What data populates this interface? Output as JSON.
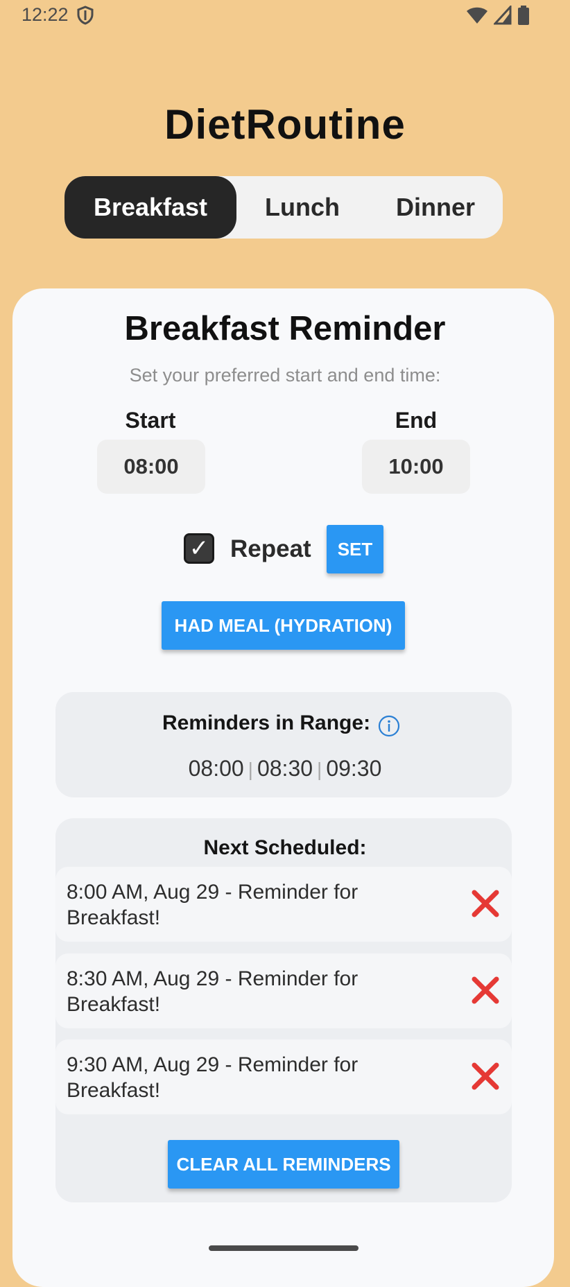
{
  "status_bar": {
    "time": "12:22",
    "left_icons": [
      "shield-icon"
    ],
    "right_icons": [
      "wifi-icon",
      "cell-signal-icon",
      "battery-icon"
    ]
  },
  "app": {
    "title": "DietRoutine"
  },
  "tabs": [
    {
      "label": "Breakfast",
      "selected": true
    },
    {
      "label": "Lunch",
      "selected": false
    },
    {
      "label": "Dinner",
      "selected": false
    }
  ],
  "reminder": {
    "title": "Breakfast Reminder",
    "subtitle": "Set your preferred start and end time:",
    "start_label": "Start",
    "start_value": "08:00",
    "end_label": "End",
    "end_value": "10:00",
    "repeat_label": "Repeat",
    "repeat_checked": true,
    "checkmark": "✓",
    "set_button": "SET",
    "had_meal_button": "HAD MEAL (HYDRATION)"
  },
  "range": {
    "title": "Reminders in Range:",
    "info_icon": "info-icon",
    "times": [
      "08:00",
      "08:30",
      "09:30"
    ],
    "separator": "|"
  },
  "scheduled": {
    "title": "Next Scheduled:",
    "items": [
      {
        "text": "8:00 AM, Aug 29 - Reminder for Breakfast!",
        "delete_icon": "cross-mark-icon"
      },
      {
        "text": "8:30 AM, Aug 29 - Reminder for Breakfast!",
        "delete_icon": "cross-mark-icon"
      },
      {
        "text": "9:30 AM, Aug 29 - Reminder for Breakfast!",
        "delete_icon": "cross-mark-icon"
      }
    ],
    "clear_button": "CLEAR ALL REMINDERS"
  },
  "colors": {
    "background": "#f3cb8e",
    "card": "#f8f9fb",
    "accent_button": "#2a97f3",
    "active_tab": "#262626",
    "delete_red": "#e53935"
  }
}
